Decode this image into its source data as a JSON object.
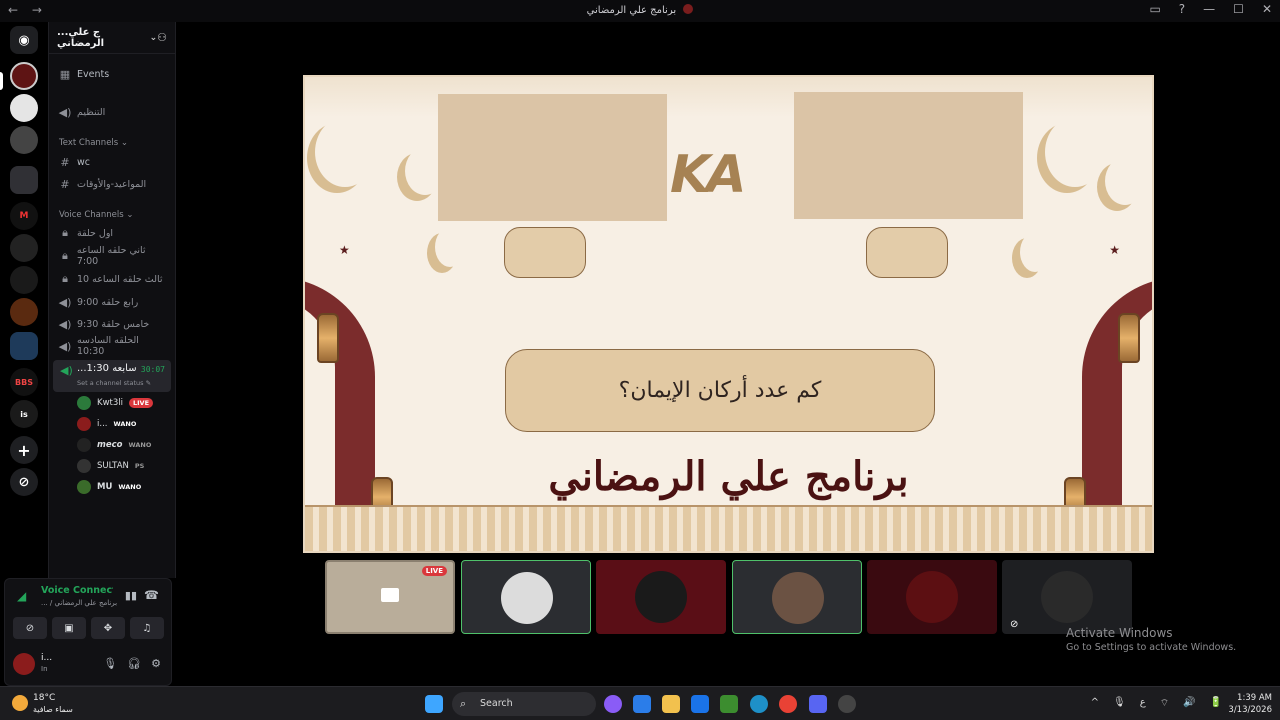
{
  "window": {
    "title": "برنامج علي الرمضاني",
    "nav_back": "←",
    "nav_forward": "→",
    "controls": [
      "▭",
      "?",
      "—",
      "☐",
      "✕"
    ]
  },
  "guilds": [
    "",
    "",
    "",
    "",
    "M",
    "",
    "",
    "",
    "",
    "BBS",
    "is",
    "+",
    "⊘"
  ],
  "server": {
    "name": "برنامج علي الرمضاني",
    "name_truncated": "...ج علي الرمضاني"
  },
  "channels": {
    "events_label": "Events",
    "top_voice": "التنظيم",
    "text_category": "Text Channels",
    "text": [
      "wc",
      "المواعيد-والأوقات"
    ],
    "voice_category": "Voice Channels",
    "voice": [
      "اول حلقة",
      "ثاني حلقه الساعه 7:00",
      "ثالث حلقه الساعه 10",
      "رابع حلقه 9:00",
      "خامس حلقة 9:30",
      "الحلقه السادسه 10:30"
    ],
    "active": {
      "name": "...سابعه 1:30",
      "timer": "30:07",
      "status": "Set a channel status"
    }
  },
  "members": [
    {
      "name": "Kwt3li",
      "badge": "LIVE",
      "color": "#2b7a3b"
    },
    {
      "name": "i...",
      "badge": "WANO",
      "color": "#8b1c1c"
    },
    {
      "name": "meco",
      "badge": "WANO",
      "color": "#222"
    },
    {
      "name": "SULTAN",
      "badge": "PS",
      "color": "#333"
    },
    {
      "name": "MU",
      "badge": "WANO",
      "color": "#3a6b2a"
    }
  ],
  "voice_panel": {
    "status": "Voice Connected",
    "channel": "... / برنامج علي الرمضاني",
    "user_name": "i...",
    "user_status": "In"
  },
  "slide": {
    "logo": "KA",
    "question": "كم عدد أركان الإيمان؟",
    "program": "برنامج علي الرمضاني"
  },
  "tiles": [
    {
      "kind": "stream",
      "live": "LIVE",
      "bg": "#b9ad9a"
    },
    {
      "kind": "user",
      "bg": "#2b2d31",
      "border": "#4fc16a",
      "avatar": "#dcdcdc"
    },
    {
      "kind": "user",
      "bg": "#5a0e16",
      "border": "#5a0e16",
      "avatar": "#1a1a1a"
    },
    {
      "kind": "user",
      "bg": "#2b2d31",
      "border": "#4fc16a",
      "avatar": "#6b5243"
    },
    {
      "kind": "user",
      "bg": "#3a0a10",
      "border": "#3a0a10",
      "avatar": "#5c0f12"
    },
    {
      "kind": "user",
      "bg": "#1e1f22",
      "border": "#1e1f22",
      "avatar": "#2a2a2a",
      "muted": true
    }
  ],
  "watermark": {
    "title": "Activate Windows",
    "subtitle": "Go to Settings to activate Windows."
  },
  "taskbar": {
    "temp": "18°C",
    "weather": "سماء صافية",
    "search": "Search",
    "clock_time": "1:39 AM",
    "clock_date": "3/13/2026",
    "tray": [
      "^",
      "🎙",
      "ع",
      "⌔",
      "🔊",
      "🔋"
    ]
  }
}
